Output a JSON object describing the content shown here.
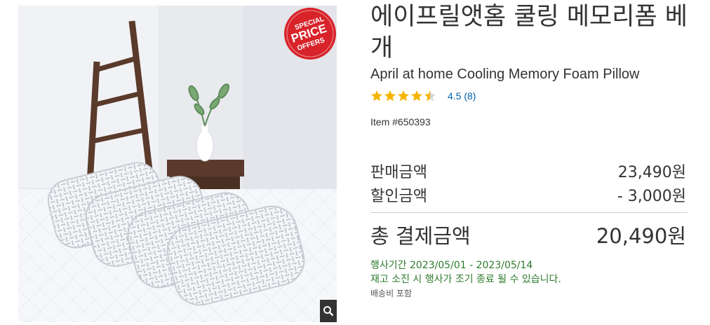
{
  "product": {
    "title_ko": "에이프릴앳홈 쿨링 메모리폼 베개",
    "title_en": "April at home Cooling Memory Foam Pillow",
    "rating": 4.5,
    "rating_text": "4.5 (8)",
    "item_number": "Item #650393"
  },
  "badge": {
    "line1": "SPECIAL",
    "line2": "PRICE",
    "line3": "OFFERS",
    "color": "#d8232a"
  },
  "pricing": {
    "sale_label": "판매금액",
    "sale_value": "23,490원",
    "discount_label": "할인금액",
    "discount_value": "- 3,000원",
    "total_label": "총 결제금액",
    "total_value": "20,490원"
  },
  "promotion": {
    "period": "행사기간 2023/05/01 - 2023/05/14",
    "notice": "재고 소진 시 행사가 조기 종료 될 수 있습니다.",
    "shipping": "배송비 포함",
    "color": "#2d7a2d"
  },
  "icons": {
    "zoom": "magnifier-icon",
    "star": "star-icon"
  },
  "colors": {
    "star": "#f5b400",
    "rating_link": "#0060a9"
  }
}
